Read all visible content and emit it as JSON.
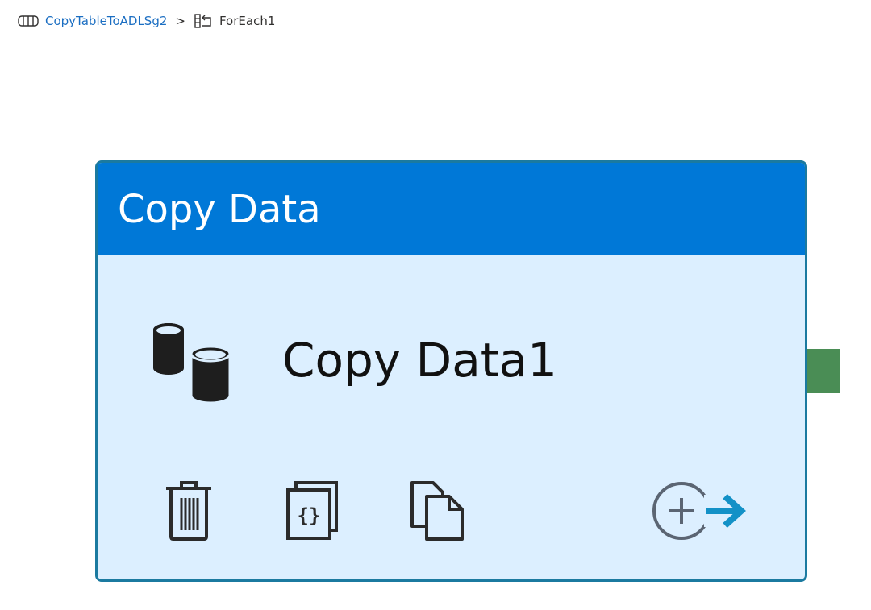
{
  "breadcrumb": {
    "pipeline_icon": "pipeline-icon",
    "pipeline_label": "CopyTableToADLSg2",
    "separator": ">",
    "foreach_icon": "foreach-icon",
    "current_label": "ForEach1"
  },
  "activity": {
    "type_label": "Copy Data",
    "name": "Copy Data1",
    "icon": "database-copy-icon",
    "header_color": "#0078d7",
    "body_color": "#dcefff",
    "border_color": "#1b7aa0",
    "actions": [
      {
        "icon": "trash-icon",
        "action": "delete"
      },
      {
        "icon": "code-icon",
        "action": "view-code"
      },
      {
        "icon": "clone-icon",
        "action": "clone"
      },
      {
        "icon": "add-output-icon",
        "action": "add-output"
      }
    ]
  },
  "output_handle": {
    "color": "#4a8d55"
  }
}
